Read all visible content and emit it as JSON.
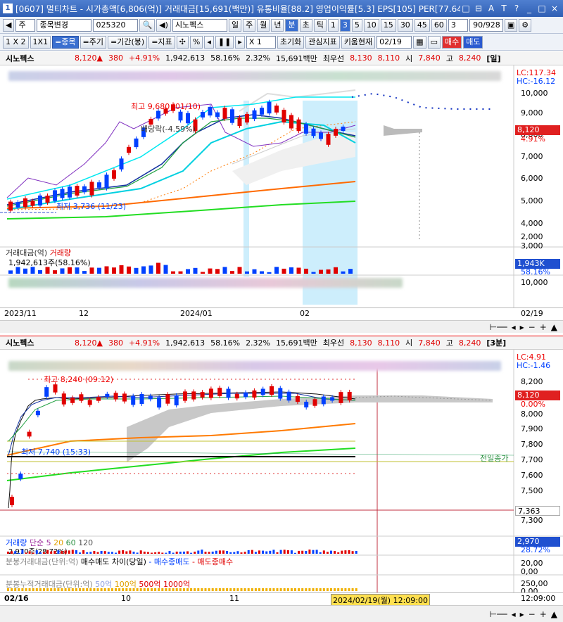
{
  "window": {
    "icon": "1",
    "title": "[0607] 멀티차트 - 시가총액[6,806(억)] 거래대금[15,691(백만)] 유통비율[88.2] 영업이익률[5.3] EPS[105] PER[77.64",
    "buttons": [
      "□",
      "⊟",
      "A",
      "T",
      "?",
      "_",
      "□",
      "×"
    ]
  },
  "toolbar1": {
    "period_prev": "◀",
    "type_select": "주",
    "type_arrow": "▾",
    "stock_change": "종목변경",
    "stock_arrow": "▾",
    "code": "025320",
    "name": "시노펙스",
    "periods": [
      "일",
      "주",
      "월",
      "년",
      "분",
      "초",
      "틱"
    ],
    "nums": [
      "1",
      "3",
      "5",
      "10",
      "15",
      "30",
      "45",
      "60"
    ],
    "count": "3",
    "range": "90/928"
  },
  "toolbar2": {
    "layout": "1 X 2",
    "ratio": "1X1",
    "items": [
      "=종목",
      "=주기",
      "=기간(봉)",
      "=지표"
    ],
    "zoom": "X 1",
    "init": "초기화",
    "interest": "관심지표",
    "kiwoom": "키움현재",
    "date": "02/19",
    "buy": "매수",
    "sell": "매도"
  },
  "panel1": {
    "name": "시노펙스",
    "price": "8,120▲",
    "change": "380",
    "pct": "+4.91%",
    "volume": "1,942,613",
    "vol_pct": "58.16%",
    "turnover": "2.32%",
    "amount": "15,691백만",
    "best_label": "최우선",
    "ask": "8,130",
    "bid": "8,110",
    "open_label": "시",
    "open": "7,840",
    "high_label": "고",
    "high": "8,240",
    "period": "[일]",
    "lc": "LC:117.34",
    "hc": "HC:-16.12",
    "max_label": "최고 9,680 (01/10)",
    "min_label": "최저 3,736 (11/23)",
    "dividend": "배당락(-4.59%)",
    "price_tag": "8,120",
    "pct_tag": "4.91%",
    "yaxis": [
      "10,000",
      "9,000",
      "8,000",
      "7,000",
      "6,000",
      "5,000",
      "4,000",
      "3,000",
      "2,000"
    ],
    "vol_title": "거래대금(억)",
    "vol_title2": "거래량",
    "vol_value": "1,942,613주(58.16%)",
    "vol_tag": "1,943K",
    "vol_tag_pct": "58.16%",
    "vol_axis": "10,000",
    "xaxis": [
      "2023/11",
      "12",
      "2024/01",
      "02",
      "02/19"
    ]
  },
  "panel2": {
    "name": "시노펙스",
    "price": "8,120▲",
    "change": "380",
    "pct": "+4.91%",
    "volume": "1,942,613",
    "vol_pct": "58.16%",
    "turnover": "2.32%",
    "amount": "15,691백만",
    "best_label": "최우선",
    "ask": "8,130",
    "bid": "8,110",
    "open_label": "시",
    "open": "7,840",
    "high_label": "고",
    "high": "8,240",
    "period": "[3분]",
    "lc": "LC:4.91",
    "hc": "HC:-1.46",
    "max_label": "최고 8,240 (09:12)",
    "min_label": "최저 7,740 (15:33)",
    "prev_close": "전일종가",
    "price_tag": "8,120",
    "pct_tag": "0.00%",
    "low_tag": "7,363",
    "yaxis": [
      "8,200",
      "8,100",
      "8,000",
      "7,900",
      "7,800",
      "7,700",
      "7,600",
      "7,500",
      "7,400",
      "7,300"
    ],
    "vol_title": "거래량",
    "vol_ma": "단순",
    "vol_ma_nums": [
      "5",
      "20",
      "60",
      "120"
    ],
    "vol_value": "2,970주(28.72%)",
    "vol_tag": "2,970",
    "vol_tag_pct": "28.72%",
    "ind1_title": "분봉거래대금(단위:억)",
    "ind1_title2": "매수매도 차이(당일)",
    "ind1_leg1": "- 매수종매도",
    "ind1_leg2": "- 매도종매수",
    "ind1_axis": "20,00",
    "ind1_axis2": "0,00",
    "ind2_title": "분봉누적거래대금(단위:억)",
    "ind2_legs": [
      "50억",
      "100억",
      "500억",
      "1000억"
    ],
    "ind2_axis": "250,00",
    "ind2_axis2": "0,00",
    "xaxis": [
      "02/16",
      "10",
      "11"
    ],
    "cursor_time": "2024/02/19(월) 12:09:00",
    "right_time": "12:09:00"
  },
  "colors": {
    "up": "#e00000",
    "down": "#0040ff",
    "title_bg": "#2f5fb4"
  }
}
